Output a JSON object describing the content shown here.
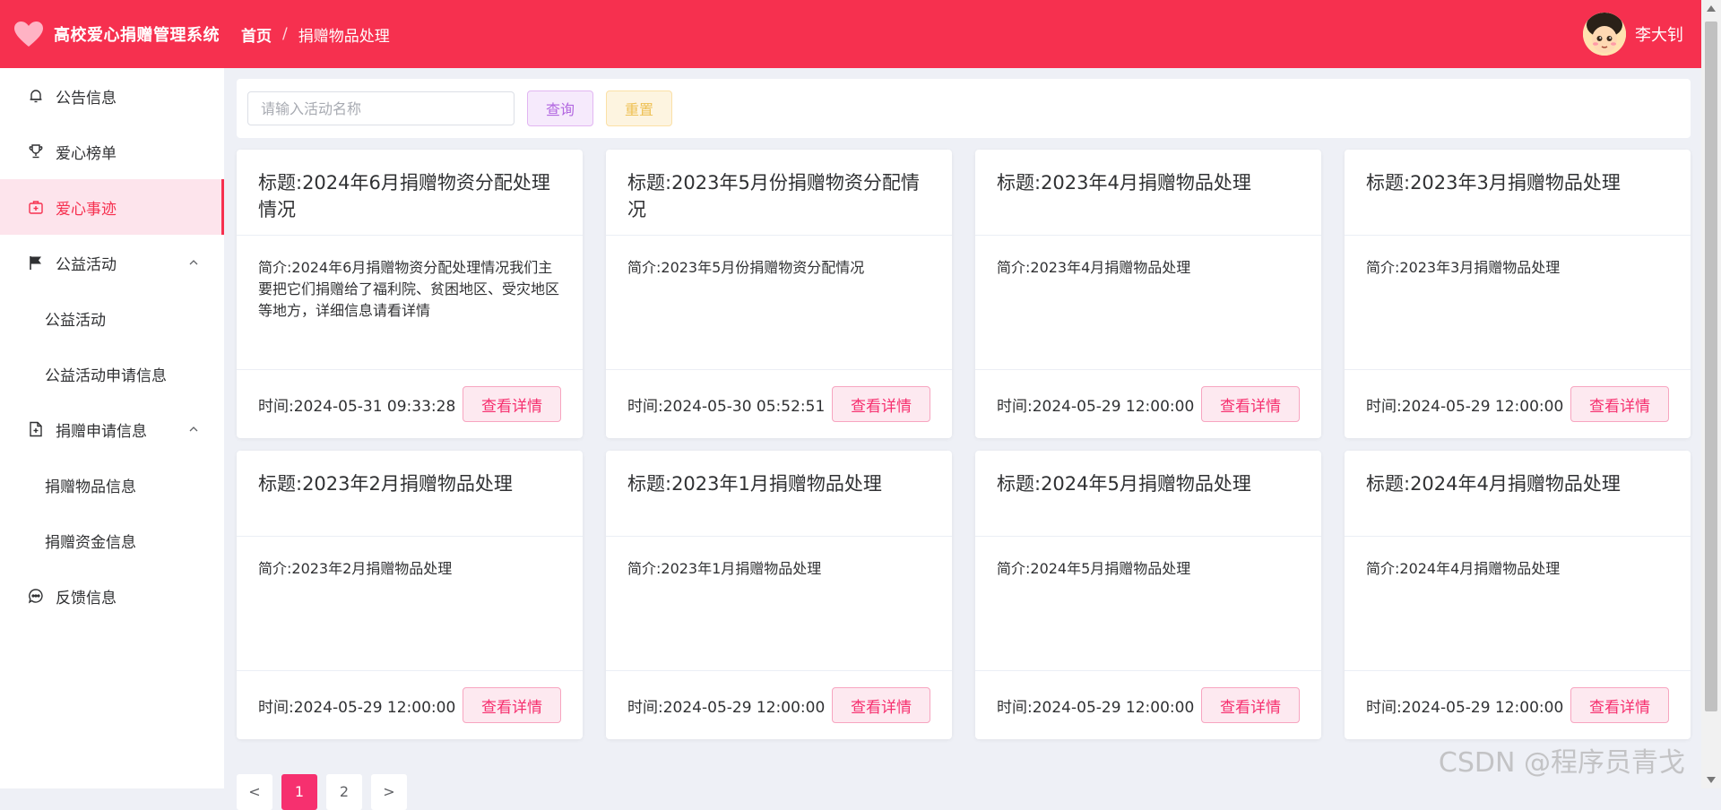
{
  "header": {
    "app_title": "高校爱心捐赠管理系统",
    "breadcrumb_home": "首页",
    "breadcrumb_sep": "/",
    "breadcrumb_current": "捐赠物品处理",
    "username": "李大钊",
    "brand_color": "#f6304f"
  },
  "sidebar": {
    "items": [
      {
        "label": "公告信息",
        "icon": "bell-icon"
      },
      {
        "label": "爱心榜单",
        "icon": "trophy-icon"
      },
      {
        "label": "爱心事迹",
        "icon": "first-aid-icon",
        "active": true
      },
      {
        "label": "公益活动",
        "icon": "flag-icon",
        "expanded": true
      },
      {
        "label": "公益活动",
        "sub": true
      },
      {
        "label": "公益活动申请信息",
        "sub": true
      },
      {
        "label": "捐赠申请信息",
        "icon": "document-add-icon",
        "expanded": true
      },
      {
        "label": "捐赠物品信息",
        "sub": true
      },
      {
        "label": "捐赠资金信息",
        "sub": true
      },
      {
        "label": "反馈信息",
        "icon": "chat-icon"
      }
    ]
  },
  "search": {
    "placeholder": "请输入活动名称",
    "value": "",
    "query_label": "查询",
    "reset_label": "重置"
  },
  "cards": [
    {
      "title": "标题:2024年6月捐赠物资分配处理情况",
      "desc": "简介:2024年6月捐赠物资分配处理情况我们主要把它们捐赠给了福利院、贫困地区、受灾地区等地方，详细信息请看详情",
      "time": "时间:2024-05-31 09:33:28",
      "button": "查看详情"
    },
    {
      "title": "标题:2023年5月份捐赠物资分配情况",
      "desc": "简介:2023年5月份捐赠物资分配情况",
      "time": "时间:2024-05-30 05:52:51",
      "button": "查看详情"
    },
    {
      "title": "标题:2023年4月捐赠物品处理",
      "desc": "简介:2023年4月捐赠物品处理",
      "time": "时间:2024-05-29 12:00:00",
      "button": "查看详情"
    },
    {
      "title": "标题:2023年3月捐赠物品处理",
      "desc": "简介:2023年3月捐赠物品处理",
      "time": "时间:2024-05-29 12:00:00",
      "button": "查看详情"
    },
    {
      "title": "标题:2023年2月捐赠物品处理",
      "desc": "简介:2023年2月捐赠物品处理",
      "time": "时间:2024-05-29 12:00:00",
      "button": "查看详情"
    },
    {
      "title": "标题:2023年1月捐赠物品处理",
      "desc": "简介:2023年1月捐赠物品处理",
      "time": "时间:2024-05-29 12:00:00",
      "button": "查看详情"
    },
    {
      "title": "标题:2024年5月捐赠物品处理",
      "desc": "简介:2024年5月捐赠物品处理",
      "time": "时间:2024-05-29 12:00:00",
      "button": "查看详情"
    },
    {
      "title": "标题:2024年4月捐赠物品处理",
      "desc": "简介:2024年4月捐赠物品处理",
      "time": "时间:2024-05-29 12:00:00",
      "button": "查看详情"
    }
  ],
  "pagination": {
    "prev": "<",
    "pages": [
      "1",
      "2"
    ],
    "current": "1",
    "next": ">"
  },
  "watermark": "CSDN @程序员青戈"
}
